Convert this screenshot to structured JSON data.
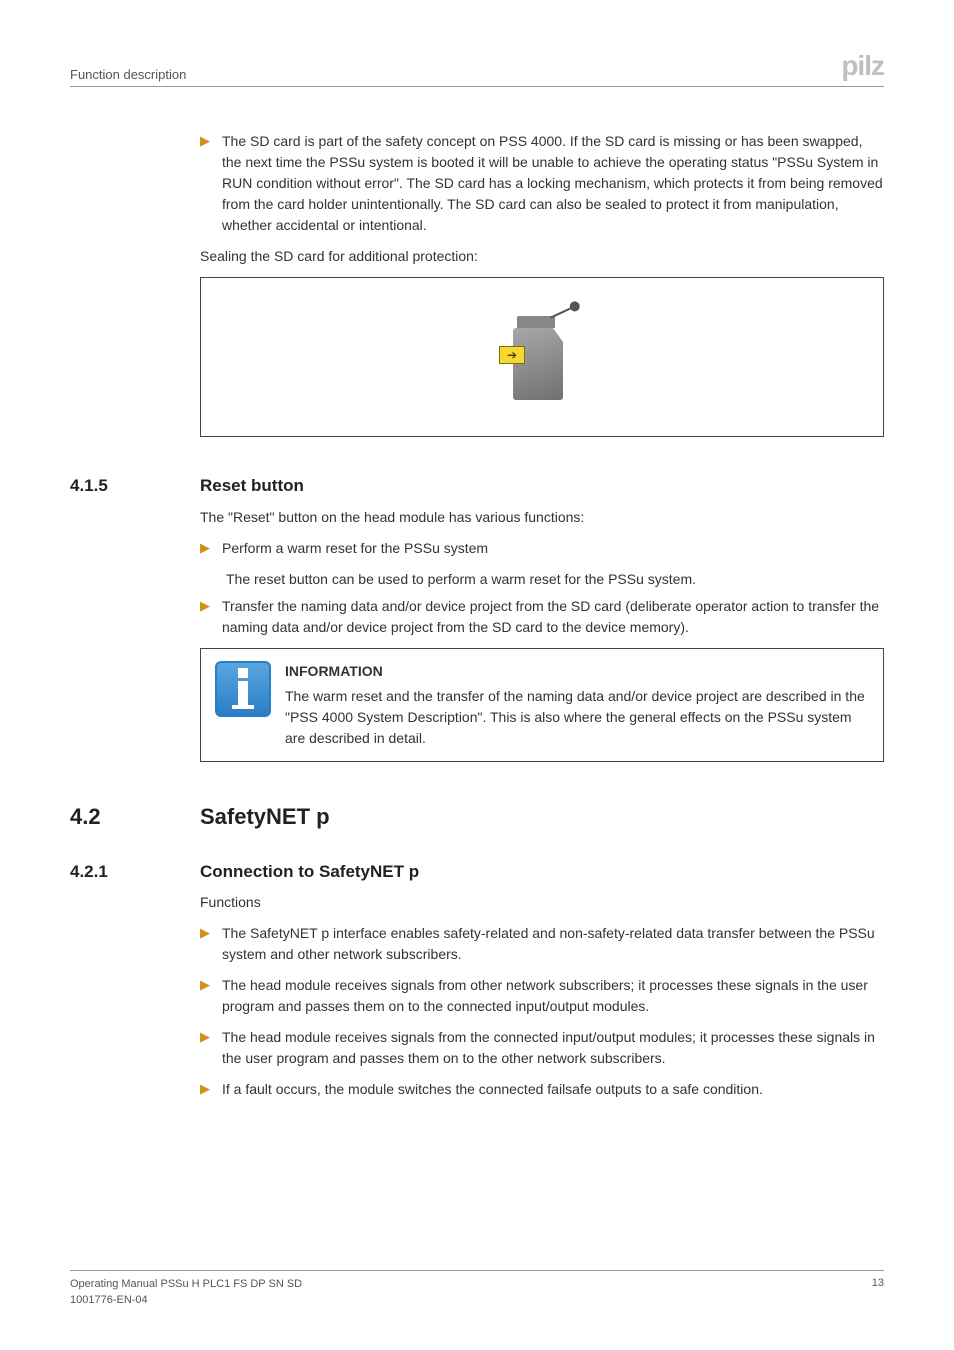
{
  "header": {
    "section_label": "Function description",
    "logo_text": "pilz"
  },
  "intro_bullets": [
    "The SD card is part of the safety concept on PSS 4000. If the SD card is missing or has been swapped, the next time the PSSu system is booted it will be unable to achieve the operating status \"PSSu System in RUN condition without error\". The SD card has a locking mechanism, which protects it from being removed from the card holder unintentionally. The SD card can also be sealed to protect it from manipulation, whether accidental or intentional."
  ],
  "sealing_caption": "Sealing the SD card for additional protection:",
  "sec415": {
    "num": "4.1.5",
    "title": "Reset button",
    "para": "The \"Reset\" button on the head module has various functions:",
    "bullets": [
      {
        "text": "Perform a warm reset for the PSSu system",
        "sub": "The reset button can be used to perform a warm reset for the PSSu system."
      },
      {
        "text": "Transfer the naming data and/or device project from the SD card (deliberate operator action to transfer the naming data and/or device project from the SD card to the device memory)."
      }
    ]
  },
  "infobox": {
    "heading": "INFORMATION",
    "body": "The warm reset and the transfer of the naming data and/or device project are described in the \"PSS 4000 System Description\". This is also where the general effects on the PSSu system are described in detail."
  },
  "sec42": {
    "num": "4.2",
    "title": "SafetyNET p"
  },
  "sec421": {
    "num": "4.2.1",
    "title": "Connection to SafetyNET p",
    "lead": "Functions",
    "bullets": [
      "The SafetyNET p interface enables safety-related and non-safety-related data transfer between the PSSu system and other network subscribers.",
      "The head module receives signals from other network subscribers; it processes these signals in the user program and passes them on to the connected input/output modules.",
      "The head module receives signals from the connected input/output modules; it processes these signals in the user program and passes them on to the other network subscribers.",
      "If a fault occurs, the module switches the connected failsafe outputs to a safe condition."
    ]
  },
  "footer": {
    "line1": "Operating Manual PSSu H PLC1 FS DP SN SD",
    "line2": "1001776-EN-04",
    "page": "13"
  }
}
